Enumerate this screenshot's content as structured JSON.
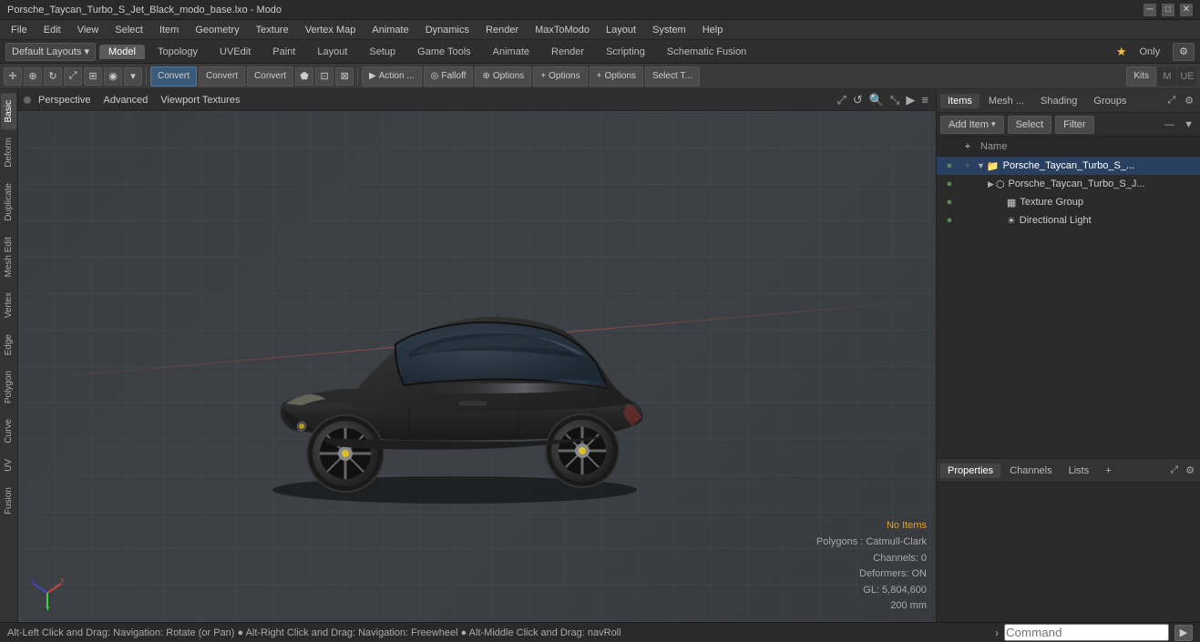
{
  "titleBar": {
    "title": "Porsche_Taycan_Turbo_S_Jet_Black_modo_base.lxo - Modo",
    "minBtn": "─",
    "maxBtn": "□",
    "closeBtn": "✕"
  },
  "menuBar": {
    "items": [
      "File",
      "Edit",
      "View",
      "Select",
      "Item",
      "Geometry",
      "Texture",
      "Vertex Map",
      "Animate",
      "Dynamics",
      "Render",
      "MaxToModo",
      "Layout",
      "System",
      "Help"
    ]
  },
  "layoutBar": {
    "dropdown": "Default Layouts ▾",
    "tabs": [
      {
        "label": "Model",
        "active": true
      },
      {
        "label": "Topology"
      },
      {
        "label": "UVEdit"
      },
      {
        "label": "Paint"
      },
      {
        "label": "Layout"
      },
      {
        "label": "Setup"
      },
      {
        "label": "Game Tools",
        "active": false
      },
      {
        "label": "Animate"
      },
      {
        "label": "Render"
      },
      {
        "label": "Scripting"
      },
      {
        "label": "Schematic Fusion"
      }
    ],
    "addBtn": "+",
    "onlyLabel": "Only",
    "settingsIcon": "⚙"
  },
  "toolbar": {
    "convert1": "Convert",
    "convert2": "Convert",
    "convert3": "Convert",
    "action": "Action ...",
    "falloff": "Falloff",
    "options1": "Options",
    "options2": "Options",
    "options3": "Options",
    "selectT": "Select T...",
    "kits": "Kits"
  },
  "leftSidebar": {
    "tabs": [
      "Basic",
      "Deform",
      "Duplicate",
      "Mesh Edit",
      "Vertex",
      "Edge",
      "Polygon",
      "Curve",
      "UV",
      "Fusion"
    ]
  },
  "viewport": {
    "dot": "●",
    "labels": [
      "Perspective",
      "Advanced",
      "Viewport Textures"
    ],
    "icons": [
      "⤢",
      "↺",
      "🔍",
      "⤡",
      "▶",
      "≡"
    ],
    "status": {
      "noItems": "No Items",
      "polygons": "Polygons : Catmull-Clark",
      "channels": "Channels: 0",
      "deformers": "Deformers: ON",
      "gl": "GL: 5,804,600",
      "size": "200 mm"
    }
  },
  "rightPanel": {
    "tabs": [
      "Items",
      "Mesh ...",
      "Shading",
      "Groups"
    ],
    "expandIcon": "⤢",
    "addIcon": "+",
    "settingsIcon": "⚙",
    "itemsToolbar": {
      "addItemBtn": "Add Item",
      "selectBtn": "Select",
      "filterBtn": "Filter"
    },
    "listHeader": {
      "nameCol": "Name"
    },
    "items": [
      {
        "id": "root",
        "eye": "●",
        "add": "+",
        "arrow": "▼",
        "icon": "📦",
        "name": "Porsche_Taycan_Turbo_S_...",
        "indent": 0,
        "selected": true
      },
      {
        "id": "mesh",
        "eye": "●",
        "add": "",
        "arrow": "▶",
        "icon": "⬡",
        "name": "Porsche_Taycan_Turbo_S_J...",
        "indent": 1
      },
      {
        "id": "texture",
        "eye": "●",
        "add": "",
        "arrow": "",
        "icon": "🔲",
        "name": "Texture Group",
        "indent": 2
      },
      {
        "id": "light",
        "eye": "●",
        "add": "",
        "arrow": "",
        "icon": "💡",
        "name": "Directional Light",
        "indent": 2
      }
    ]
  },
  "bottomPanel": {
    "tabs": [
      "Properties",
      "Channels",
      "Lists"
    ],
    "addBtn": "+",
    "expandIcon": "⤢",
    "settingsIcon": "⚙"
  },
  "statusBar": {
    "text": "Alt-Left Click and Drag: Navigation: Rotate (or Pan) ● Alt-Right Click and Drag: Navigation: Freewheel ● Alt-Middle Click and Drag: navRoll",
    "arrow": "›",
    "commandPlaceholder": "Command",
    "runIcon": "▶"
  }
}
